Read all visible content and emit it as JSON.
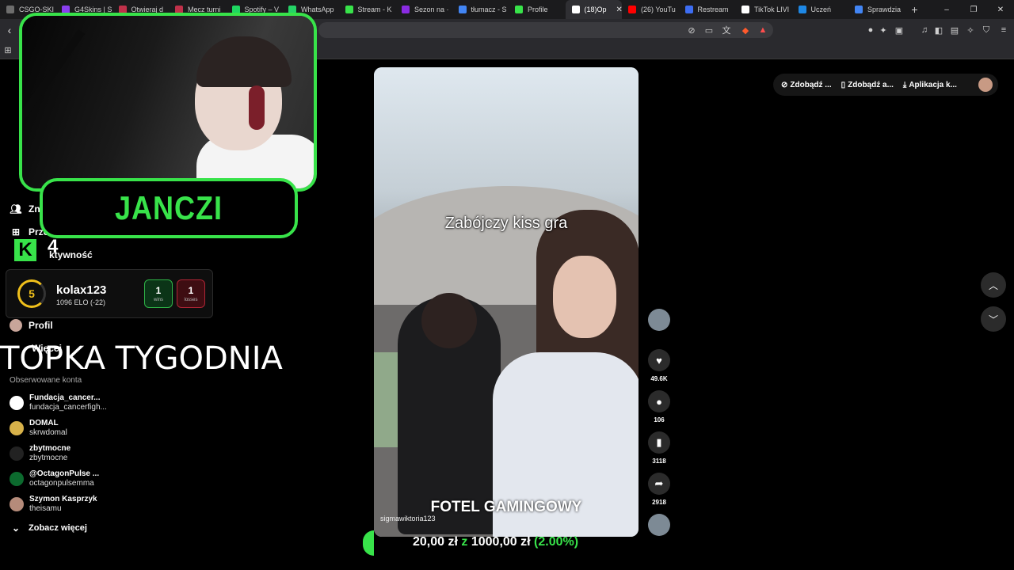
{
  "browser": {
    "tabs": [
      {
        "label": "CSGO-SKI",
        "color": "#6d6d6d"
      },
      {
        "label": "G4Skins | S",
        "color": "#8a3ff0"
      },
      {
        "label": "Otwieraj d",
        "color": "#c0314a"
      },
      {
        "label": "Mecz turni",
        "color": "#c0314a"
      },
      {
        "label": "Spotify – V",
        "color": "#1ed760"
      },
      {
        "label": "WhatsApp",
        "color": "#25d366"
      },
      {
        "label": "Stream - K",
        "color": "#38e34a"
      },
      {
        "label": "Sezon na ·",
        "color": "#8a2be2"
      },
      {
        "label": "tłumacz - S",
        "color": "#4285f4"
      },
      {
        "label": "Profile",
        "color": "#38e34a"
      },
      {
        "label": "(18)Op",
        "color": "#ffffff",
        "active": true
      },
      {
        "label": "(26) YouTu",
        "color": "#ff0000"
      },
      {
        "label": "Restream",
        "color": "#3d6df2"
      },
      {
        "label": "TikTok LIVI",
        "color": "#ffffff"
      },
      {
        "label": "Uczeń",
        "color": "#1e88e5"
      },
      {
        "label": "Sprawdzia",
        "color": "#4285f4"
      }
    ],
    "new_tab_label": "+",
    "window_controls": [
      "–",
      "❐",
      "✕"
    ],
    "back_label": "‹",
    "apps_label": "⊞"
  },
  "sidebar": {
    "items": [
      {
        "label": "Zn",
        "icon": "friends-icon"
      },
      {
        "label": "Prze",
        "icon": "upload-icon"
      },
      {
        "label": "ktywność",
        "icon": "activity-icon"
      },
      {
        "label": "Profil",
        "icon": "profile-icon"
      },
      {
        "label": "Więcej",
        "icon": "more-icon"
      }
    ],
    "following_header": "Obserwowane konta",
    "following": [
      {
        "name": "Fundacja_cancer...",
        "handle": "fundacja_cancerfigh...",
        "color": "#ffffff"
      },
      {
        "name": "DOMAL",
        "handle": "skrwdomal",
        "color": "#d8b24a"
      },
      {
        "name": "zbytmocne",
        "handle": "zbytmocne",
        "color": "#222222"
      },
      {
        "name": "@OctagonPulse ...",
        "handle": "octagonpulsemma",
        "color": "#0c6a2e"
      },
      {
        "name": "Szymon Kasprzyk",
        "handle": "theisamu",
        "color": "#b58b7a"
      }
    ],
    "see_more": "Zobacz więcej"
  },
  "overlay": {
    "streamer_name": "JANCZI",
    "k_badge": "K",
    "k_count": "4",
    "elo_card": {
      "level": "5",
      "username": "kolax123",
      "elo_text": "1096 ELO (-22)",
      "wins_value": "1",
      "wins_label": "wins",
      "losses_value": "1",
      "losses_label": "losses"
    },
    "banner": "TOPKA TYGODNIA"
  },
  "topbar": {
    "pills": [
      "Zdobądź ...",
      "Zdobądź a...",
      "Aplikacja k..."
    ]
  },
  "video": {
    "caption_top": "Zabójczy kiss gra",
    "caption_bottom": "FOTEL GAMINGOWY",
    "username": "sigmawiktoria123"
  },
  "actions": {
    "likes": "49.6K",
    "comments": "106",
    "saves": "3118",
    "shares": "2918"
  },
  "donation": {
    "current": "20,00 zł",
    "separator": "z",
    "goal": "1000,00 zł",
    "percent": "(2.00%)",
    "progress": 0.02
  }
}
